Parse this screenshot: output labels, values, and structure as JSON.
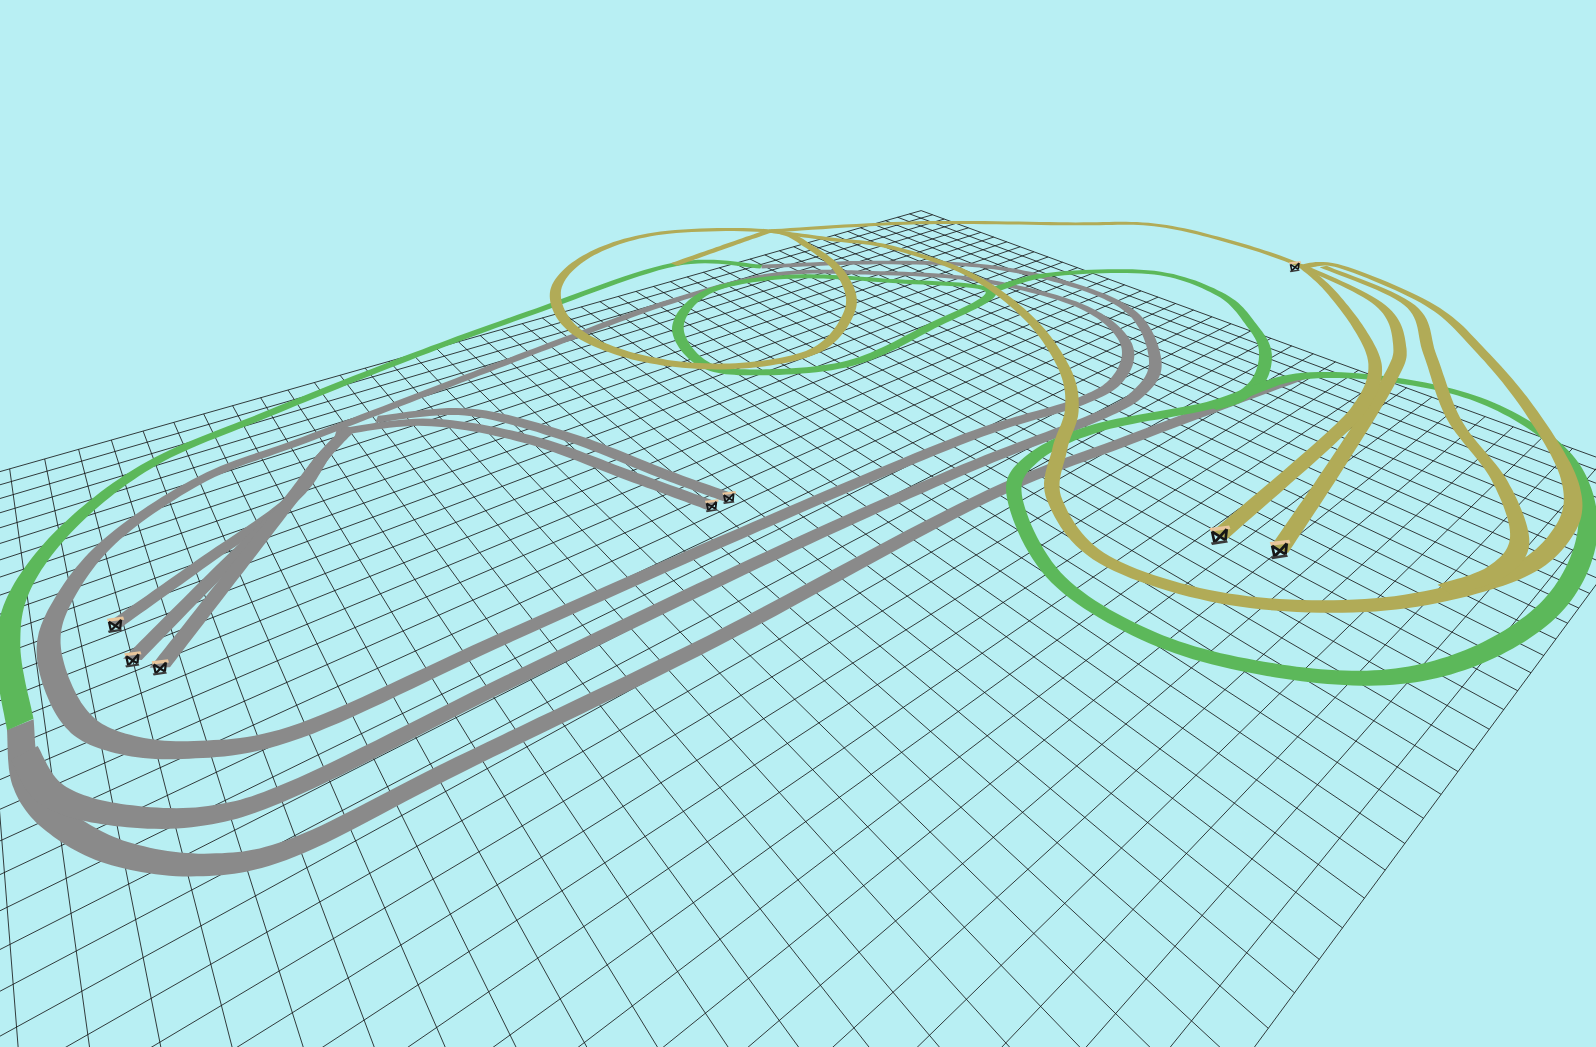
{
  "layout_view": {
    "track_levels": [
      {
        "color": "#8a8a8a"
      },
      {
        "color": "#5cb85a"
      },
      {
        "color": "#b1ab57"
      }
    ]
  }
}
